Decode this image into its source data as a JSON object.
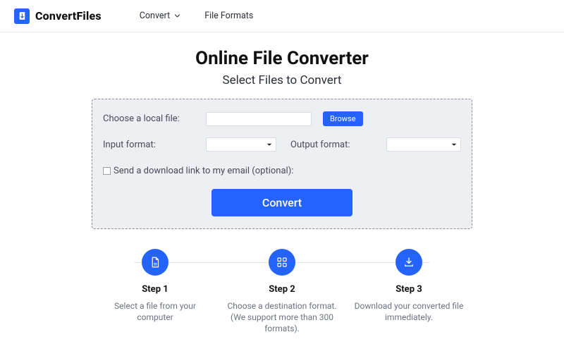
{
  "header": {
    "brand": "ConvertFiles",
    "nav": {
      "convert": "Convert",
      "formats": "File Formats"
    }
  },
  "hero": {
    "title": "Online File Converter",
    "subtitle": "Select Files to Convert"
  },
  "form": {
    "choose_label": "Choose a local file:",
    "browse_label": "Browse",
    "input_format_label": "Input format:",
    "output_format_label": "Output format:",
    "email_label": "Send a download link to my email (optional):",
    "convert_label": "Convert"
  },
  "steps": [
    {
      "title": "Step 1",
      "desc": "Select a file from your computer"
    },
    {
      "title": "Step 2",
      "desc": "Choose a destination format. (We support more than 300 formats)."
    },
    {
      "title": "Step 3",
      "desc": "Download your converted file immediately."
    }
  ]
}
